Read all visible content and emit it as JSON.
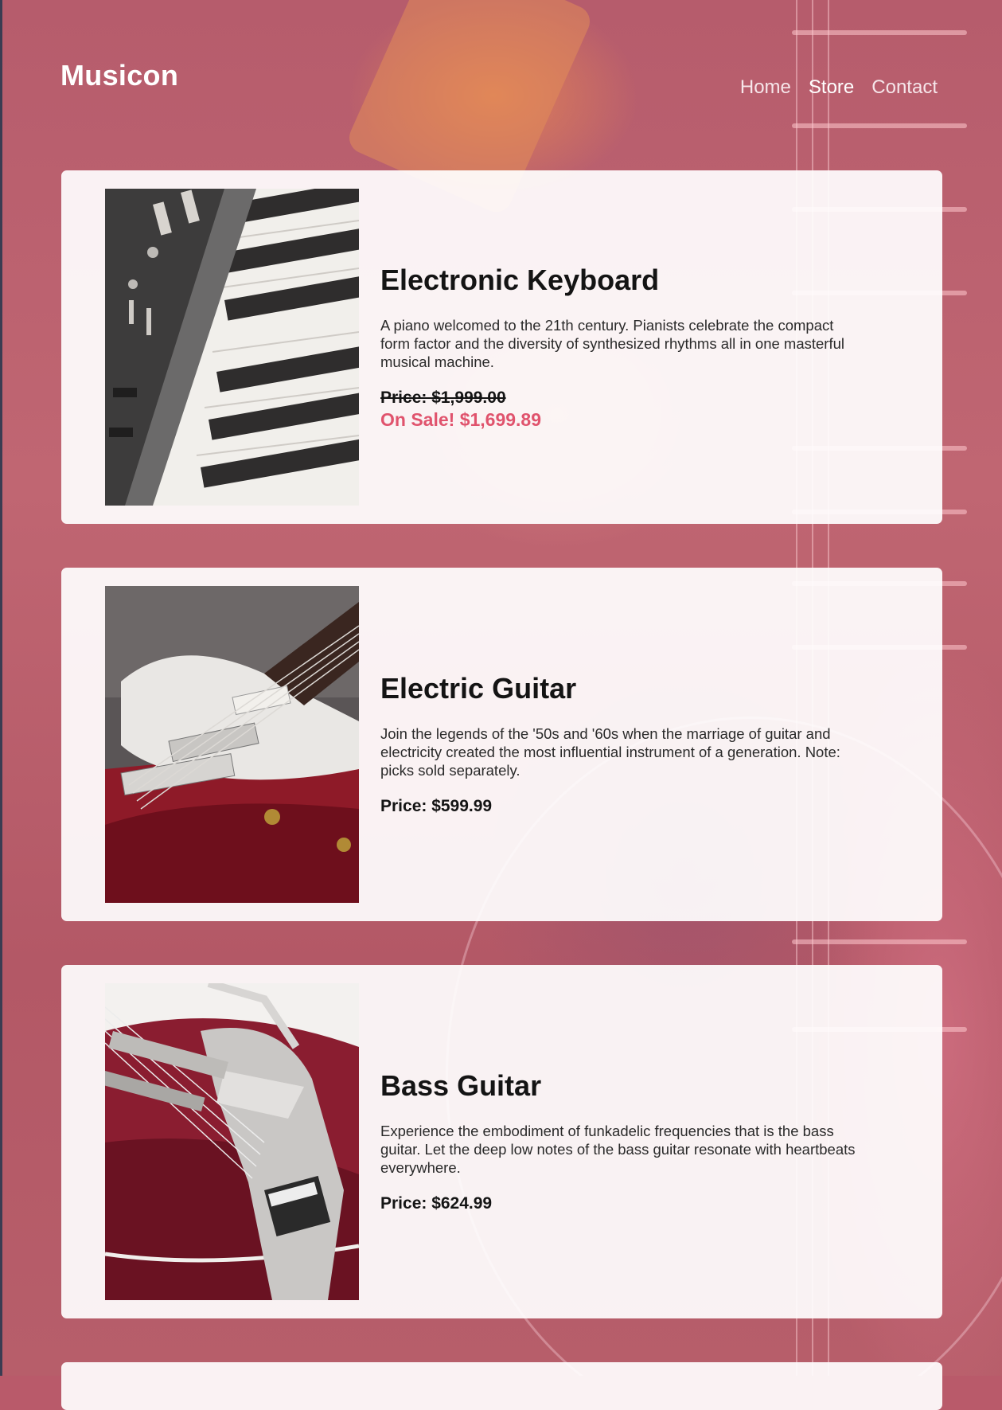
{
  "site": {
    "logo": "Musicon"
  },
  "nav": {
    "items": [
      {
        "label": "Home"
      },
      {
        "label": "Store"
      },
      {
        "label": "Contact"
      }
    ]
  },
  "products": [
    {
      "title": "Electronic Keyboard",
      "description": "A piano welcomed to the 21th century. Pianists celebrate the compact form factor and the diversity of synthesized rhythms all in one masterful musical machine.",
      "price": "Price: $1,999.00",
      "sale": "On Sale! $1,699.89"
    },
    {
      "title": "Electric Guitar",
      "description": "Join the legends of the '50s and '60s when the marriage of guitar and electricity created the most influential instrument of a generation. Note: picks sold separately.",
      "price": "Price: $599.99"
    },
    {
      "title": "Bass Guitar",
      "description": "Experience the embodiment of funkadelic frequencies that is the bass guitar. Let the deep low notes of the bass guitar resonate with heartbeats everywhere.",
      "price": "Price: $624.99"
    }
  ],
  "colors": {
    "sale": "#e0536d",
    "background": "#b95a6a"
  }
}
